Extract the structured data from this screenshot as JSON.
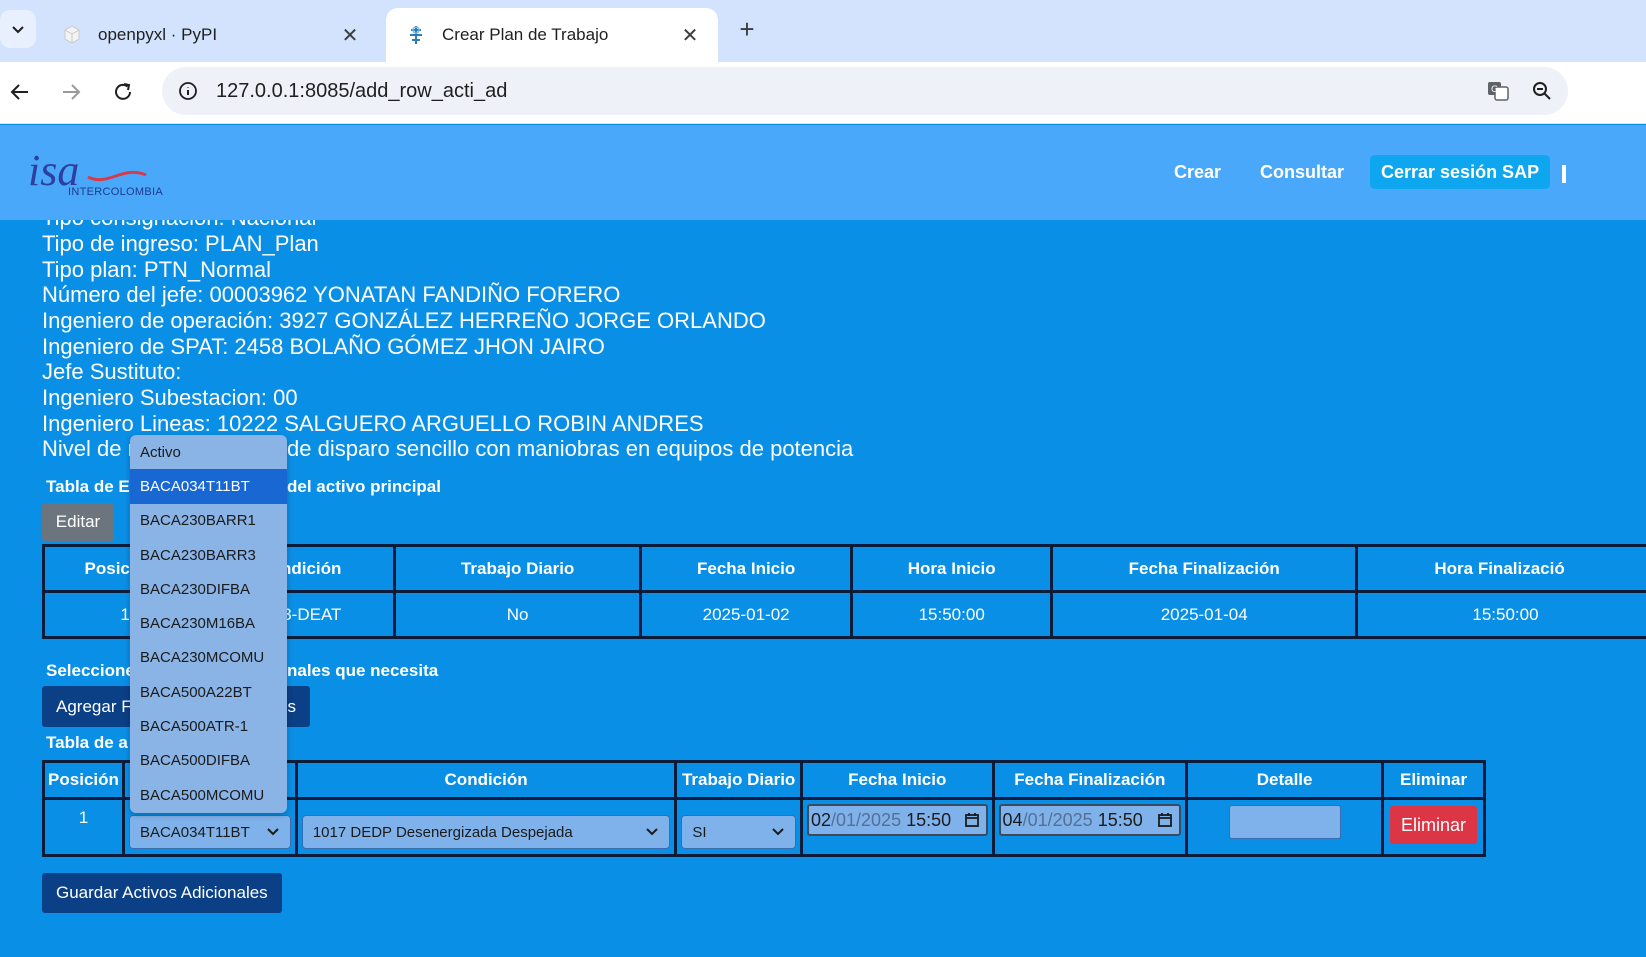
{
  "browser": {
    "tabs": [
      {
        "title": "openpyxl · PyPI",
        "active": false
      },
      {
        "title": "Crear Plan de Trabajo",
        "active": true
      }
    ],
    "url": "127.0.0.1:8085/add_row_acti_ad"
  },
  "header": {
    "logo_text": "isa",
    "logo_sub": "INTERCOLOMBIA",
    "nav": [
      "Crear",
      "Consultar"
    ],
    "nav_pill": "Cerrar sesión SAP"
  },
  "info_lines": [
    "Tipo consignación: Nacional",
    "Tipo de ingreso: PLAN_Plan",
    "Tipo plan: PTN_Normal",
    "Número del jefe: 00003962 YONATAN FANDIÑO FORERO",
    "Ingeniero de operación: 3927 GONZÁLEZ HERREÑO JORGE ORLANDO",
    "Ingeniero de SPAT: 2458 BOLAÑO GÓMEZ JHON JAIRO",
    "Jefe Sustituto:",
    "Ingeniero Subestacion: 00",
    "Ingeniero Lineas: 10222 SALGUERO ARGUELLO ROBIN ANDRES",
    "Nivel de r",
    "de disparo sencillo con maniobras en equipos de potencia"
  ],
  "table1": {
    "label_left": "Tabla de E",
    "label_right": "del activo principal",
    "edit_button": "Editar",
    "headers": [
      "Posic",
      "ndición",
      "Trabajo Diario",
      "Fecha Inicio",
      "Hora Inicio",
      "Fecha Finalización",
      "Hora Finalizació"
    ],
    "row": [
      "1",
      "3-DEAT",
      "No",
      "2025-01-02",
      "15:50:00",
      "2025-01-04",
      "15:50:00"
    ]
  },
  "additional": {
    "select_label_left": "Seleccione",
    "select_label_right": "nales que necesita",
    "add_button_left": "Agregar F",
    "add_button_right": "es",
    "table_label": "Tabla de a",
    "headers": [
      "Posición",
      "Condición",
      "Trabajo Diario",
      "Fecha Inicio",
      "Fecha Finalización",
      "Detalle",
      "Eliminar"
    ],
    "row": {
      "position": "1",
      "asset": "BACA034T11BT",
      "condition": "1017 DEDP Desenergizada Despejada",
      "daily": "SI",
      "start_date": {
        "dd": "02",
        "mm": "01",
        "yyyy": "2025",
        "time": "15:50"
      },
      "end_date": {
        "dd": "04",
        "mm": "01",
        "yyyy": "2025",
        "time": "15:50"
      },
      "delete_button": "Eliminar"
    },
    "save_button": "Guardar Activos Adicionales"
  },
  "dropdown": {
    "options": [
      "Activo",
      "BACA034T11BT",
      "BACA230BARR1",
      "BACA230BARR3",
      "BACA230DIFBA",
      "BACA230M16BA",
      "BACA230MCOMU",
      "BACA500A22BT",
      "BACA500ATR-1",
      "BACA500DIFBA",
      "BACA500MCOMU"
    ],
    "selected": "BACA034T11BT"
  },
  "colors": {
    "page_bg": "#0a8fe6",
    "header_bg": "#4aa8fb",
    "danger": "#dc3545",
    "primary_dark": "#0b3f86"
  }
}
